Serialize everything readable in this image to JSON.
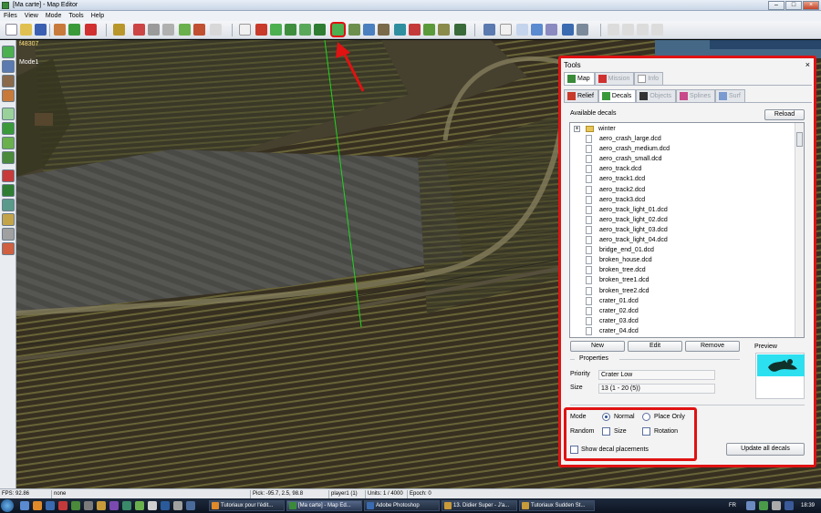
{
  "window": {
    "title": "[Ma carte] - Map Editor",
    "controls": [
      "–",
      "□",
      "×"
    ]
  },
  "menu": [
    "Files",
    "View",
    "Mode",
    "Tools",
    "Help"
  ],
  "viewport": {
    "coord_label": "f48307",
    "mode_label": "Mode1"
  },
  "tools_panel": {
    "title": "Tools",
    "close": "×",
    "main_tabs": [
      "Map",
      "Mission",
      "Info"
    ],
    "sub_tabs": [
      "Relief",
      "Decals",
      "Objects",
      "Splines",
      "Surf"
    ],
    "available_label": "Available decals",
    "reload_label": "Reload",
    "folder": "winter",
    "decals": [
      "aero_crash_large.dcd",
      "aero_crash_medium.dcd",
      "aero_crash_small.dcd",
      "aero_track.dcd",
      "aero_track1.dcd",
      "aero_track2.dcd",
      "aero_track3.dcd",
      "aero_track_light_01.dcd",
      "aero_track_light_02.dcd",
      "aero_track_light_03.dcd",
      "aero_track_light_04.dcd",
      "bridge_end_01.dcd",
      "broken_house.dcd",
      "broken_tree.dcd",
      "broken_tree1.dcd",
      "broken_tree2.dcd",
      "crater_01.dcd",
      "crater_02.dcd",
      "crater_03.dcd",
      "crater_04.dcd"
    ],
    "new_label": "New",
    "edit_label": "Edit",
    "remove_label": "Remove",
    "preview_label": "Preview",
    "properties_label": "Properties",
    "priority_label": "Priority",
    "priority_value": "Crater Low",
    "size_label": "Size",
    "size_value": "13 (1 - 20 (5))",
    "mode_label": "Mode",
    "mode_normal": "Normal",
    "mode_place_only": "Place Only",
    "mode_selected": "Normal",
    "random_label": "Random",
    "random_size": "Size",
    "random_rotation": "Rotation",
    "show_placements": "Show decal placements",
    "update_all": "Update all decals"
  },
  "status_bar": {
    "fps": "FPS: 92.86",
    "selection": "none",
    "pick": "Pick: -95.7, 2.5, 98.8",
    "player": "player1 (1)",
    "units": "Units: 1 / 4000",
    "epoch": "Epoch: 0"
  },
  "taskbar": {
    "tasks": [
      "Tutoriaux pour l'édit...",
      "[Ma carte] - Map Ed...",
      "Adobe Photoshop",
      "13. Didier Super - J'a...",
      "Tutoriaux Sudden St..."
    ],
    "active_task": "[Ma carte] - Map Ed...",
    "lang": "FR",
    "clock": "18:39"
  }
}
